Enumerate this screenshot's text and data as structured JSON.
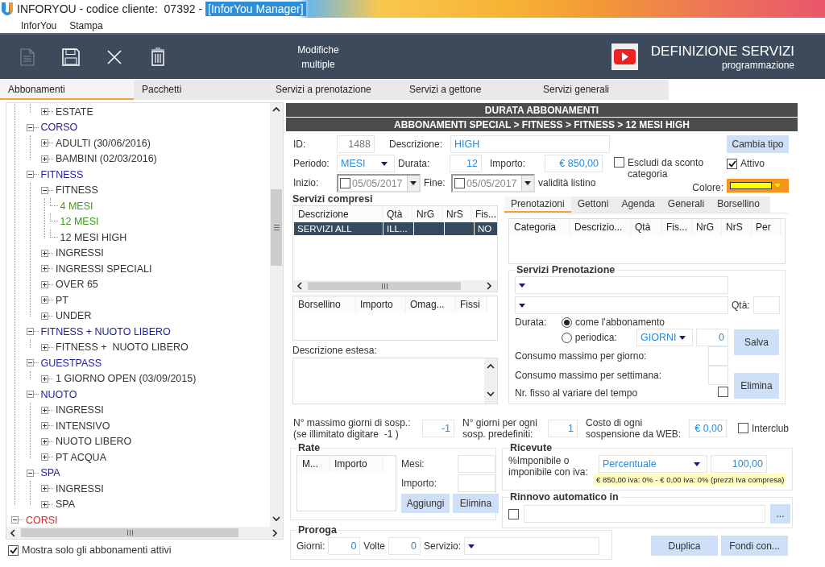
{
  "window": {
    "title": "INFORYOU - codice cliente:  07392 -",
    "document": "[InforYou Manager]"
  },
  "menu": [
    "InforYou",
    "Stampa"
  ],
  "toolbar": {
    "buttons": [
      {
        "kind": "new",
        "disabled": true
      },
      {
        "kind": "save",
        "disabled": false
      },
      {
        "kind": "close",
        "disabled": false
      },
      {
        "kind": "delete",
        "disabled": false
      }
    ],
    "multi_edit": "Modifiche multiple",
    "title": "DEFINIZIONE SERVIZI",
    "subtitle": "programmazione"
  },
  "tabs": [
    {
      "label": "Abbonamenti",
      "selected": true
    },
    {
      "label": "Pacchetti",
      "selected": false
    },
    {
      "label": "Servizi a prenotazione",
      "selected": false
    },
    {
      "label": "Servizi a gettone",
      "selected": false
    },
    {
      "label": "Servizi generali",
      "selected": false
    }
  ],
  "tree": {
    "items": [
      {
        "children": [
          {
            "children": [
              {
                "label": "ESTATE",
                "color": "#333333",
                "expanded": false
              }
            ]
          },
          {
            "label": "CORSO",
            "color": "#1c1c9e",
            "expanded": true,
            "children": [
              {
                "label": "ADULTI (30/06/2016)",
                "color": "#333333",
                "expanded": false
              },
              {
                "label": "BAMBINI (02/03/2016)",
                "color": "#333333",
                "expanded": false
              }
            ]
          },
          {
            "label": "FITNESS",
            "color": "#1c1c9e",
            "expanded": true,
            "children": [
              {
                "label": "FITNESS",
                "color": "#333333",
                "expanded": true,
                "children": [
                  {
                    "label": "4 MESI",
                    "color": "#3f9a1c"
                  },
                  {
                    "label": "12 MESI",
                    "color": "#3f9a1c"
                  },
                  {
                    "label": "12 MESI HIGH",
                    "color": "#333333"
                  }
                ]
              },
              {
                "label": "INGRESSI",
                "color": "#333333",
                "expanded": false
              },
              {
                "label": "INGRESSI SPECIALI",
                "color": "#333333",
                "expanded": false
              },
              {
                "label": "OVER 65",
                "color": "#333333",
                "expanded": false
              },
              {
                "label": "PT",
                "color": "#333333",
                "expanded": false
              },
              {
                "label": "UNDER",
                "color": "#333333",
                "expanded": false
              }
            ]
          },
          {
            "label": "FITNESS + NUOTO LIBERO",
            "color": "#1c1c9e",
            "expanded": true,
            "children": [
              {
                "label": "FITNESS +  NUOTO LIBERO",
                "color": "#333333",
                "expanded": false
              }
            ]
          },
          {
            "label": "GUESTPASS",
            "color": "#1c1c9e",
            "expanded": true,
            "children": [
              {
                "label": "1 GIORNO OPEN (03/09/2015)",
                "color": "#333333",
                "expanded": false
              }
            ]
          },
          {
            "label": "NUOTO",
            "color": "#1c1c9e",
            "expanded": true,
            "children": [
              {
                "label": "INGRESSI",
                "color": "#333333",
                "expanded": false
              },
              {
                "label": "INTENSIVO",
                "color": "#333333",
                "expanded": false
              },
              {
                "label": "NUOTO LIBERO",
                "color": "#333333",
                "expanded": false
              },
              {
                "label": "PT ACQUA",
                "color": "#333333",
                "expanded": false
              }
            ]
          },
          {
            "label": "SPA",
            "color": "#1c1c9e",
            "expanded": true,
            "children": [
              {
                "label": "INGRESSI",
                "color": "#333333",
                "expanded": false
              },
              {
                "label": "SPA",
                "color": "#333333",
                "expanded": false
              }
            ]
          }
        ]
      },
      {
        "label": "CORSI",
        "color": "#ee2222",
        "expanded": true
      }
    ]
  },
  "show_active_only": {
    "label": "Mostra solo gli abbonamenti attivi",
    "checked": true
  },
  "detail": {
    "header": "DURATA ABBONAMENTI",
    "breadcrumb": "ABBONAMENTI SPECIAL > FITNESS > FITNESS > 12 MESI HIGH",
    "id": {
      "label": "ID:",
      "value": "1488"
    },
    "descrizione": {
      "label": "Descrizione:",
      "value": "HIGH"
    },
    "cambia_tipo": "Cambia tipo",
    "periodo": {
      "label": "Periodo:",
      "value": "MESI"
    },
    "durata": {
      "label": "Durata:",
      "value": "12"
    },
    "importo": {
      "label": "Importo:",
      "value": "€ 850,00"
    },
    "escludi": {
      "label": "Escludi da sconto categoria",
      "checked": false
    },
    "attivo": {
      "label": "Attivo",
      "checked": true
    },
    "inizio": {
      "label": "Inizio:",
      "value": "05/05/2017",
      "checked": false
    },
    "fine": {
      "label": "Fine:",
      "value": "05/05/2017",
      "checked": false
    },
    "validita": "validità listino",
    "colore": "Colore:",
    "servizi_compresi": {
      "title": "Servizi compresi",
      "columns": [
        "Descrizione",
        "Qtà",
        "NrG",
        "NrS",
        "Fis..."
      ],
      "rows": [
        {
          "cells": [
            "SERVIZI ALL",
            "ILL...",
            null,
            null,
            "NO"
          ],
          "selected": true
        }
      ]
    },
    "borsellino_columns": [
      "Borsellino",
      "Importo",
      "Omag...",
      "Fissi"
    ],
    "descrizione_estesa": "Descrizione estesa:",
    "side_tabs": [
      {
        "label": "Prenotazioni",
        "selected": true
      },
      {
        "label": "Gettoni",
        "selected": false
      },
      {
        "label": "Agenda",
        "selected": false
      },
      {
        "label": "Generali",
        "selected": false
      },
      {
        "label": "Borsellino",
        "selected": false
      }
    ],
    "side_columns": [
      "Categoria",
      "Descrizio...",
      "Qtà",
      "Fis...",
      "NrG",
      "NrS",
      "Per"
    ],
    "servizi_prenotazione": {
      "title": "Servizi Prenotazione",
      "qta": "Qtà:",
      "durata": "Durata:",
      "options": [
        {
          "label": "come l'abbonamento",
          "selected": true
        },
        {
          "label": "periodica:",
          "selected": false
        }
      ],
      "unit": "GIORNI",
      "count": "0",
      "salva": "Salva",
      "per_giorno": "Consumo massimo per giorno:",
      "per_settimana": "Consumo massimo per settimana:",
      "elimina": "Elimina",
      "fisso": {
        "label": "Nr. fisso al variare del tempo",
        "checked": false
      }
    },
    "sospensioni": [
      {
        "label": "N° massimo giorni di sosp.:\n(se illimitato digitare  -1 )",
        "value": "-1"
      },
      {
        "label": "N° giorni per ogni\nsosp. predefiniti:",
        "value": "1"
      },
      {
        "label": "Costo di ogni\nsospensione da WEB:",
        "value": "€ 0,00"
      }
    ],
    "interclub": {
      "label": "Interclub",
      "checked": false
    },
    "rate": {
      "title": "Rate",
      "columns": [
        "M...",
        "Importo"
      ],
      "mesi": "Mesi:",
      "importo": "Importo:",
      "aggiungi": "Aggiungi",
      "elimina": "Elimina"
    },
    "ricevute": {
      "title": "Ricevute",
      "label": "%Imponibile o\nimponibile con iva:",
      "mode": "Percentuale",
      "value": "100,00",
      "note": "€ 850,00 iva: 0% - € 0,00 iva: 0% (prezzi Iva compresa)"
    },
    "rinnovo": {
      "title": "Rinnovo automatico in",
      "checked": false,
      "browse": "..."
    },
    "proroga": {
      "title": "Proroga",
      "giorni_label": "Giorni:",
      "giorni": "0",
      "volte_label": "Volte",
      "volte": "0",
      "servizio_label": "Servizio:"
    },
    "actions": [
      "Duplica",
      "Fondi con..."
    ]
  }
}
